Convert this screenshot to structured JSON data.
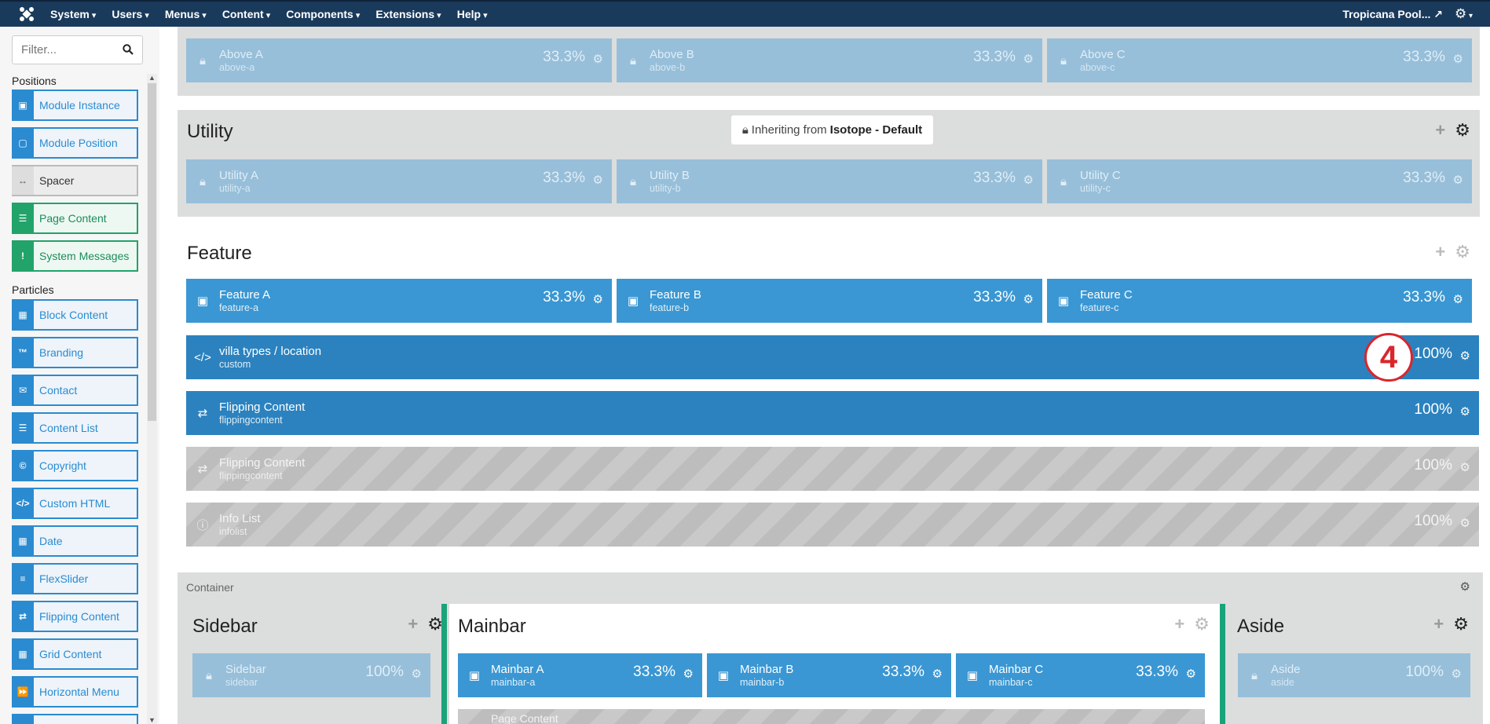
{
  "topbar": {
    "menu": [
      "System",
      "Users",
      "Menus",
      "Content",
      "Components",
      "Extensions",
      "Help"
    ],
    "site_name": "Tropicana Pool...",
    "icons": [
      "joomla-logo-icon",
      "external-link-icon",
      "gear-icon"
    ]
  },
  "sidebar": {
    "filter_placeholder": "Filter...",
    "positions_heading": "Positions",
    "positions": [
      "Module Instance",
      "Module Position",
      "Spacer",
      "Page Content",
      "System Messages"
    ],
    "particles_heading": "Particles",
    "particles": [
      "Block Content",
      "Branding",
      "Contact",
      "Content List",
      "Copyright",
      "Custom HTML",
      "Date",
      "FlexSlider",
      "Flipping Content",
      "Grid Content",
      "Horizontal Menu"
    ]
  },
  "above": {
    "blocks": [
      {
        "title": "Above A",
        "key": "above-a",
        "size": "33.3%"
      },
      {
        "title": "Above B",
        "key": "above-b",
        "size": "33.3%"
      },
      {
        "title": "Above C",
        "key": "above-c",
        "size": "33.3%"
      }
    ]
  },
  "utility": {
    "title": "Utility",
    "inherit_label": "Inheriting from",
    "inherit_source": "Isotope - Default",
    "blocks": [
      {
        "title": "Utility A",
        "key": "utility-a",
        "size": "33.3%"
      },
      {
        "title": "Utility B",
        "key": "utility-b",
        "size": "33.3%"
      },
      {
        "title": "Utility C",
        "key": "utility-c",
        "size": "33.3%"
      }
    ]
  },
  "feature": {
    "title": "Feature",
    "blocks": [
      {
        "title": "Feature A",
        "key": "feature-a",
        "size": "33.3%"
      },
      {
        "title": "Feature B",
        "key": "feature-b",
        "size": "33.3%"
      },
      {
        "title": "Feature C",
        "key": "feature-c",
        "size": "33.3%"
      }
    ],
    "rows": [
      {
        "title": "villa types / location",
        "key": "custom",
        "size": "100%"
      },
      {
        "title": "Flipping Content",
        "key": "flippingcontent",
        "size": "100%"
      },
      {
        "title": "Flipping Content",
        "key": "flippingcontent",
        "size": "100%"
      },
      {
        "title": "Info List",
        "key": "infolist",
        "size": "100%"
      }
    ]
  },
  "badge": "4",
  "container": {
    "label": "Container",
    "sidebar": {
      "title": "Sidebar",
      "block": {
        "title": "Sidebar",
        "key": "sidebar",
        "size": "100%"
      }
    },
    "mainbar": {
      "title": "Mainbar",
      "blocks": [
        {
          "title": "Mainbar A",
          "key": "mainbar-a",
          "size": "33.3%"
        },
        {
          "title": "Mainbar B",
          "key": "mainbar-b",
          "size": "33.3%"
        },
        {
          "title": "Mainbar C",
          "key": "mainbar-c",
          "size": "33.3%"
        }
      ],
      "partial": "Page Content"
    },
    "aside": {
      "title": "Aside",
      "block": {
        "title": "Aside",
        "key": "aside",
        "size": "100%"
      }
    }
  }
}
